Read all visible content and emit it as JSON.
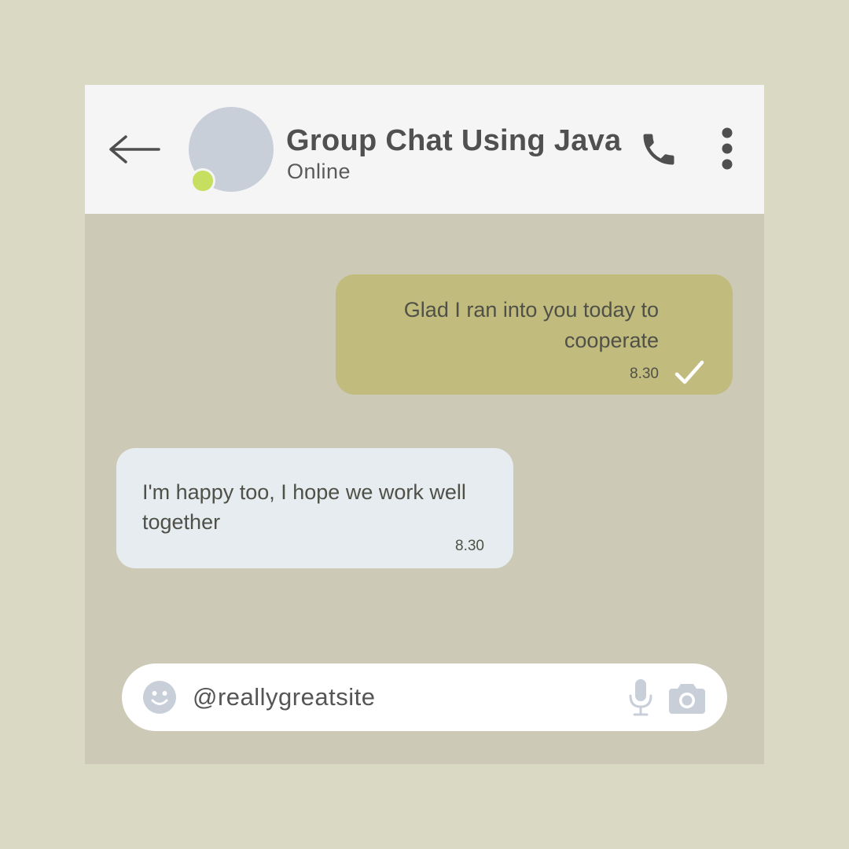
{
  "header": {
    "title": "Group Chat Using Java",
    "status": "Online",
    "icons": {
      "back": "arrow-left-icon",
      "call": "phone-icon",
      "menu": "more-vertical-icon"
    }
  },
  "messages": [
    {
      "direction": "outgoing",
      "text": "Glad I ran into you today to cooperate",
      "time": "8.30",
      "status_icon": "check-icon"
    },
    {
      "direction": "incoming",
      "text": "I'm happy too, I hope we work well together",
      "time": "8.30"
    }
  ],
  "composer": {
    "placeholder": "@reallygreatsite",
    "icons": {
      "emoji": "smiley-icon",
      "mic": "microphone-icon",
      "camera": "camera-icon"
    }
  },
  "colors": {
    "page_background": "#dad9c4",
    "chat_background": "#ccc9b7",
    "header_background": "#f5f5f5",
    "outgoing_bubble": "#c2bb7e",
    "incoming_bubble": "#e6ecef",
    "online_indicator": "#c6df60",
    "avatar": "#c8cfd9",
    "icon_muted": "#c8cfd9"
  }
}
